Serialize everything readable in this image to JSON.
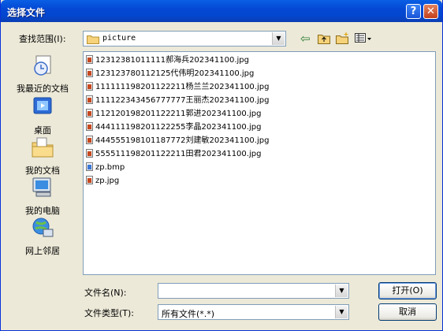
{
  "window": {
    "title": "选择文件"
  },
  "titlebar": {
    "help_glyph": "?",
    "close_glyph": "✕"
  },
  "lookin": {
    "label": "查找范围(I):",
    "value": "picture"
  },
  "toolbar": {
    "back_glyph": "⇦",
    "up_glyph": "🗀",
    "newfolder_glyph": "🗁",
    "views_glyph": "▦▾"
  },
  "places": [
    {
      "label": "我最近的文档",
      "icon": "recent-documents-icon"
    },
    {
      "label": "桌面",
      "icon": "desktop-icon"
    },
    {
      "label": "我的文档",
      "icon": "my-documents-icon"
    },
    {
      "label": "我的电脑",
      "icon": "my-computer-icon"
    },
    {
      "label": "网上邻居",
      "icon": "network-places-icon"
    }
  ],
  "files": [
    {
      "name": "12312381011111郝海兵202341100.jpg",
      "type": "jpg"
    },
    {
      "name": "123123780112125代伟明202341100.jpg",
      "type": "jpg"
    },
    {
      "name": "111111198201122211杨兰兰202341100.jpg",
      "type": "jpg"
    },
    {
      "name": "111122343456777777王丽杰202341100.jpg",
      "type": "jpg"
    },
    {
      "name": "112120198201122211郭进202341100.jpg",
      "type": "jpg"
    },
    {
      "name": "444111198201122255李晶202341100.jpg",
      "type": "jpg"
    },
    {
      "name": "444555198101187772刘建敏202341100.jpg",
      "type": "jpg"
    },
    {
      "name": "555511198201122211田君202341100.jpg",
      "type": "jpg"
    },
    {
      "name": "zp.bmp",
      "type": "bmp"
    },
    {
      "name": "zp.jpg",
      "type": "jpg"
    }
  ],
  "filename": {
    "label": "文件名(N):",
    "value": ""
  },
  "filetype": {
    "label": "文件类型(T):",
    "value": "所有文件(*.*)"
  },
  "buttons": {
    "open": "打开(O)",
    "cancel": "取消"
  },
  "colors": {
    "titlebar": "#0a5fe5",
    "dialog_bg": "#ece9d8",
    "close_button": "#c4401c"
  }
}
